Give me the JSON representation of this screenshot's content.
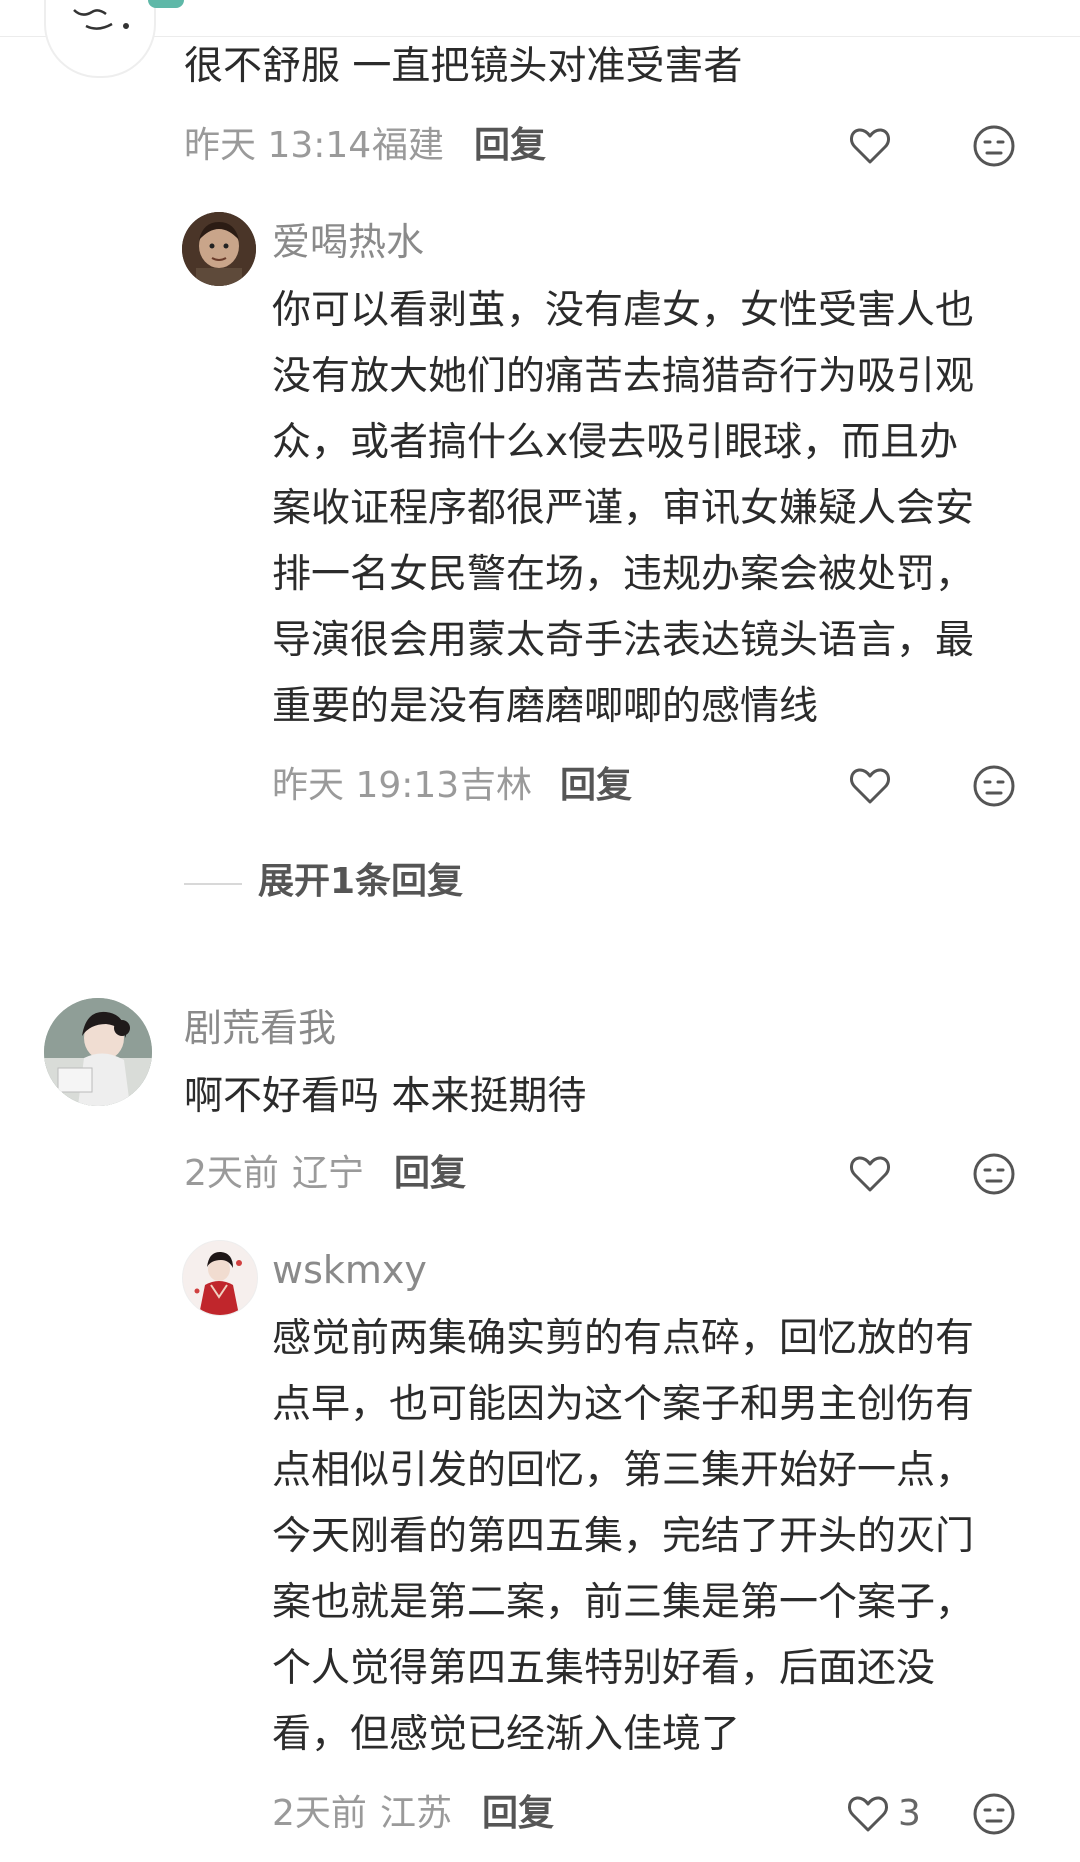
{
  "comments": [
    {
      "text_lines": [
        "很不舒服 一直把镜头对准受害者"
      ],
      "time": "昨天 13:14",
      "location": "福建",
      "reply_label": "回复",
      "replies": [
        {
          "username": "爱喝热水",
          "text_lines": [
            "你可以看剥茧，没有虐女，女性受害人也",
            "没有放大她们的痛苦去搞猎奇行为吸引观",
            "众，或者搞什么x侵去吸引眼球，而且办",
            "案收证程序都很严谨，审讯女嫌疑人会安",
            "排一名女民警在场，违规办案会被处罚，",
            "导演很会用蒙太奇手法表达镜头语言，最",
            "重要的是没有磨磨唧唧的感情线"
          ],
          "time": "昨天 19:13",
          "location": "吉林",
          "reply_label": "回复"
        }
      ],
      "expand_label": "展开1条回复"
    },
    {
      "username": "剧荒看我",
      "text_lines": [
        "啊不好看吗  本来挺期待"
      ],
      "time": "2天前",
      "location": "辽宁",
      "reply_label": "回复",
      "replies": [
        {
          "username": "wskmxy",
          "text_lines": [
            "感觉前两集确实剪的有点碎，回忆放的有",
            "点早，也可能因为这个案子和男主创伤有",
            "点相似引发的回忆，第三集开始好一点，",
            "今天刚看的第四五集，完结了开头的灭门",
            "案也就是第二案，前三集是第一个案子，",
            "个人觉得第四五集特别好看，后面还没",
            "看，但感觉已经渐入佳境了"
          ],
          "time": "2天前",
          "location": "江苏",
          "reply_label": "回复",
          "like_count": "3"
        }
      ]
    }
  ],
  "icons": {
    "like": "heart-outline-icon",
    "react": "emoji-face-icon"
  },
  "colors": {
    "text": "#2b2b2b",
    "meta": "#9a9a9a",
    "username": "#8a8a8a",
    "icon": "#555555"
  }
}
